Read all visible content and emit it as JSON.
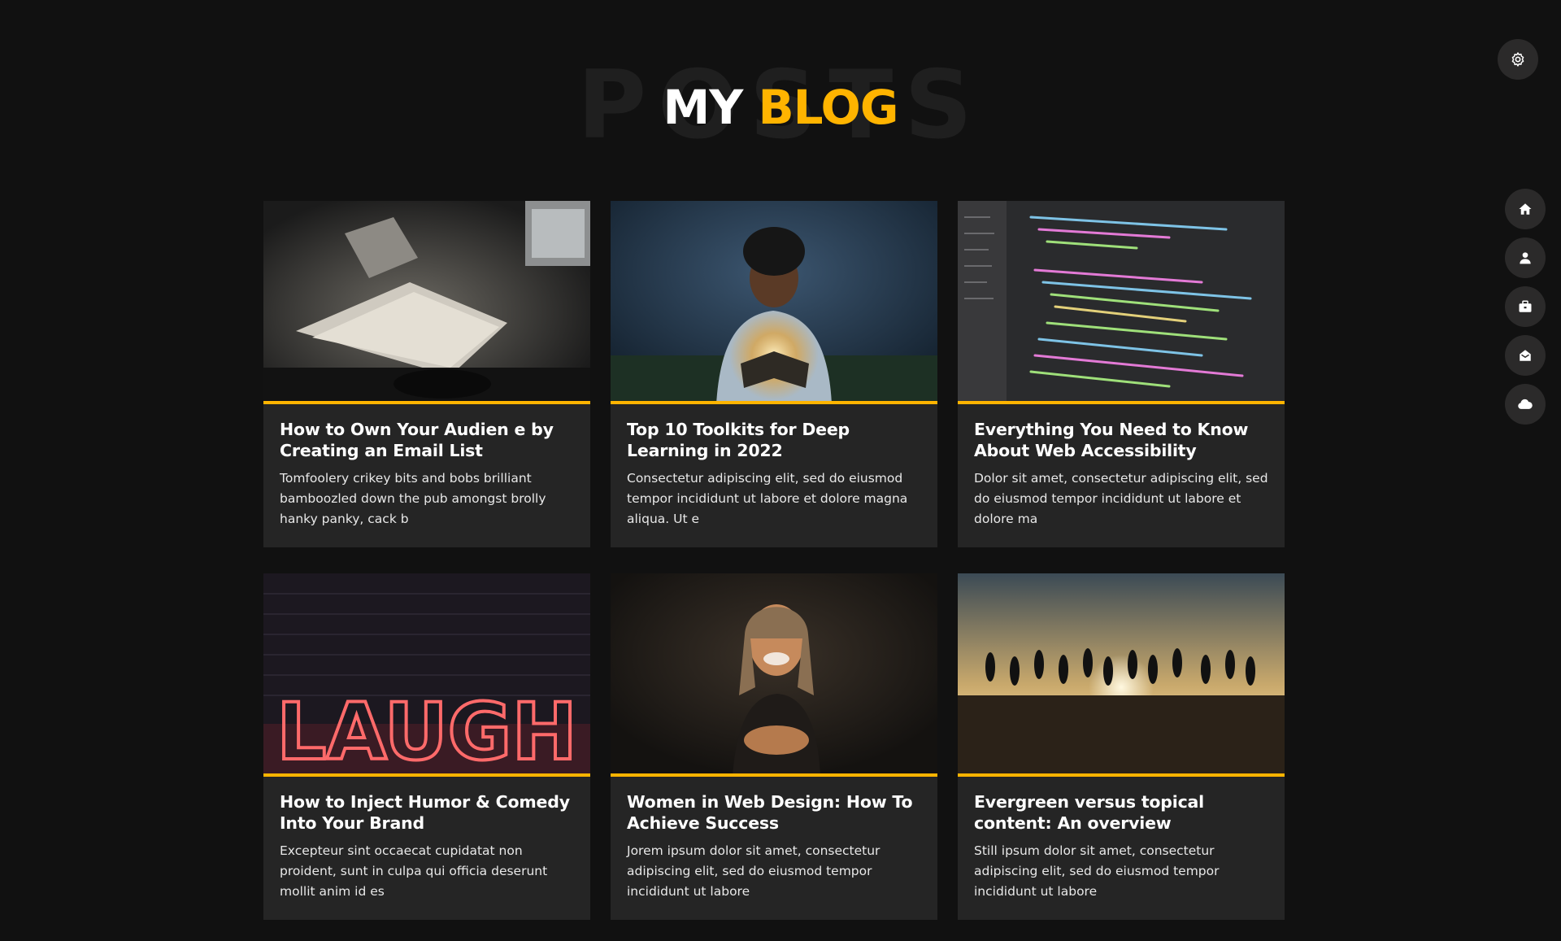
{
  "header": {
    "background_word": "POSTS",
    "title_part1": "MY",
    "title_part2": "BLOG"
  },
  "colors": {
    "accent": "#ffb400",
    "background": "#111111",
    "card": "#252525"
  },
  "settings": {
    "icon": "gear-icon"
  },
  "nav": [
    {
      "icon": "home-icon"
    },
    {
      "icon": "user-icon"
    },
    {
      "icon": "briefcase-icon"
    },
    {
      "icon": "envelope-open-icon"
    },
    {
      "icon": "cloud-icon"
    }
  ],
  "posts": [
    {
      "title": "How to Own Your Audien e by Creating an Email List",
      "excerpt": "Tomfoolery crikey bits and bobs brilliant bamboozled down the pub amongst brolly hanky panky, cack b"
    },
    {
      "title": "Top 10 Toolkits for Deep Learning in 2022",
      "excerpt": "Consectetur adipiscing elit, sed do eiusmod tempor incididunt ut labore et dolore magna aliqua. Ut e"
    },
    {
      "title": "Everything You Need to Know About Web Accessibility",
      "excerpt": "Dolor sit amet, consectetur adipiscing elit, sed do eiusmod tempor incididunt ut labore et dolore ma"
    },
    {
      "title": "How to Inject Humor & Comedy Into Your Brand",
      "excerpt": "Excepteur sint occaecat cupidatat non proident, sunt in culpa qui officia deserunt mollit anim id es",
      "image_text": "LAUGH"
    },
    {
      "title": "Women in Web Design: How To Achieve Success",
      "excerpt": "Jorem ipsum dolor sit amet, consectetur adipiscing elit, sed do eiusmod tempor incididunt ut labore"
    },
    {
      "title": "Evergreen versus topical content: An overview",
      "excerpt": "Still ipsum dolor sit amet, consectetur adipiscing elit, sed do eiusmod tempor incididunt ut labore"
    }
  ]
}
